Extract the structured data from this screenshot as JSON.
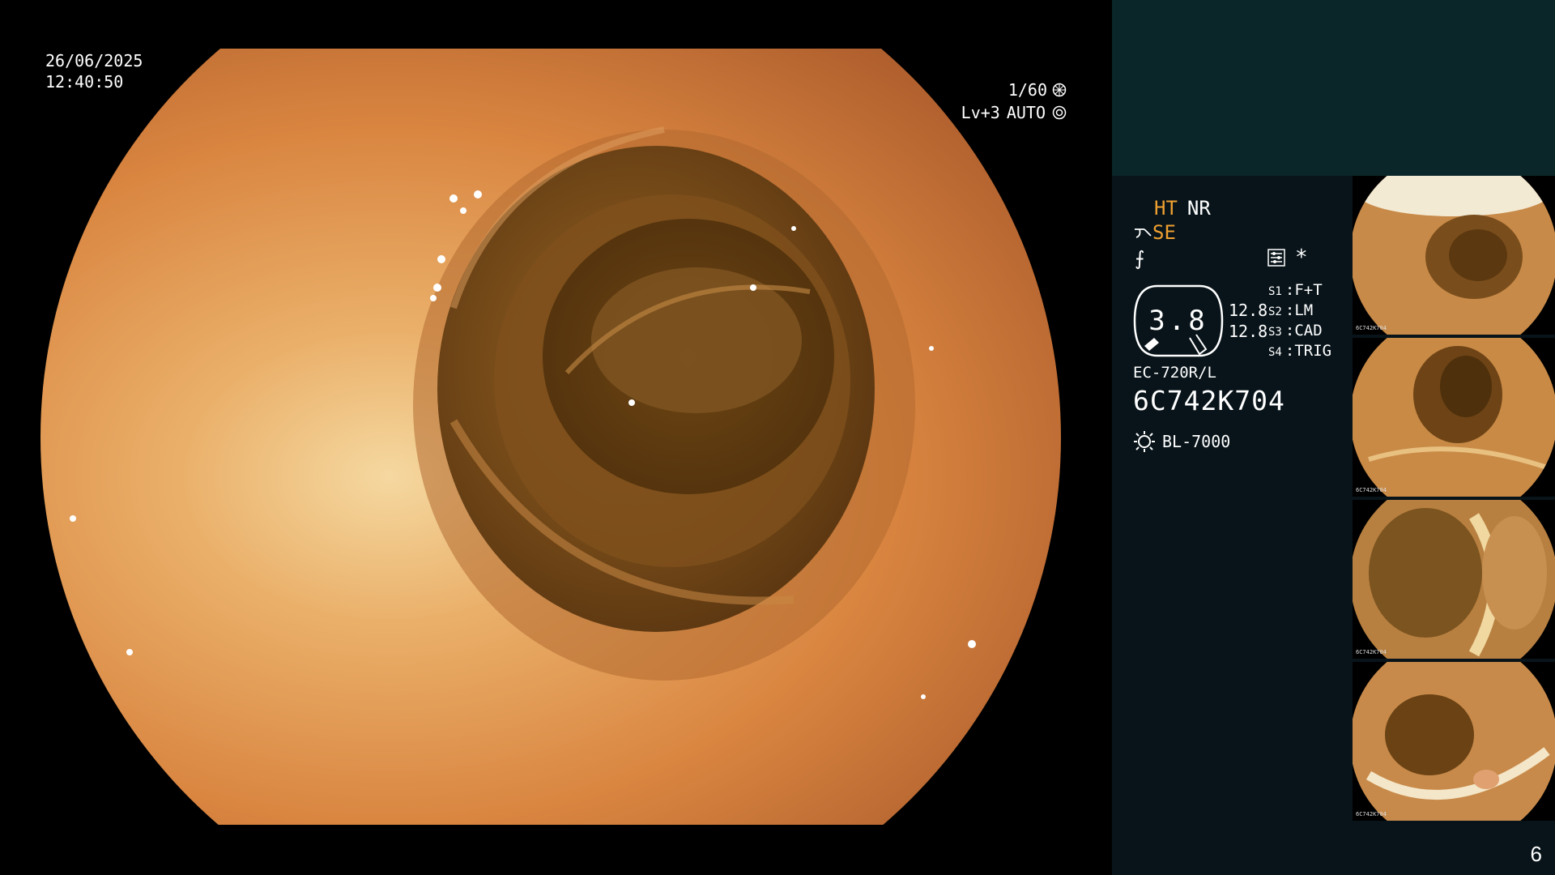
{
  "osd": {
    "date": "26/06/2025",
    "time": "12:40:50",
    "shutter": "1/60",
    "level": "Lv+3",
    "iris_mode": "AUTO"
  },
  "panel": {
    "ht": "HT",
    "nr": "NR",
    "se": "SE",
    "sigma_glyph": "⨍",
    "star": "*",
    "gauge_value": "3.8",
    "gauge_left_1": "12.8",
    "gauge_left_2": "12.8",
    "switches": [
      {
        "key": "S1",
        "value": "F+T"
      },
      {
        "key": "S2",
        "value": "LM"
      },
      {
        "key": "S3",
        "value": "CAD"
      },
      {
        "key": "S4",
        "value": "TRIG"
      }
    ],
    "scope_model": "EC-720R/L",
    "scope_serial": "6C742K704",
    "light_source": "BL-7000"
  },
  "thumbnails": [
    {
      "caption_serial": "6C742K704"
    },
    {
      "caption_serial": "6C742K704"
    },
    {
      "caption_serial": "6C742K704"
    },
    {
      "caption_serial": "6C742K704"
    }
  ],
  "page_number": "6",
  "colors": {
    "tissue_light": "#f2c88a",
    "tissue_mid": "#d9843e",
    "tissue_dark": "#7a4a1c",
    "lumen": "#6b4418",
    "panel_bg": "#08141a",
    "teal_bg": "#0a2628",
    "accent_orange": "#f0a030"
  }
}
